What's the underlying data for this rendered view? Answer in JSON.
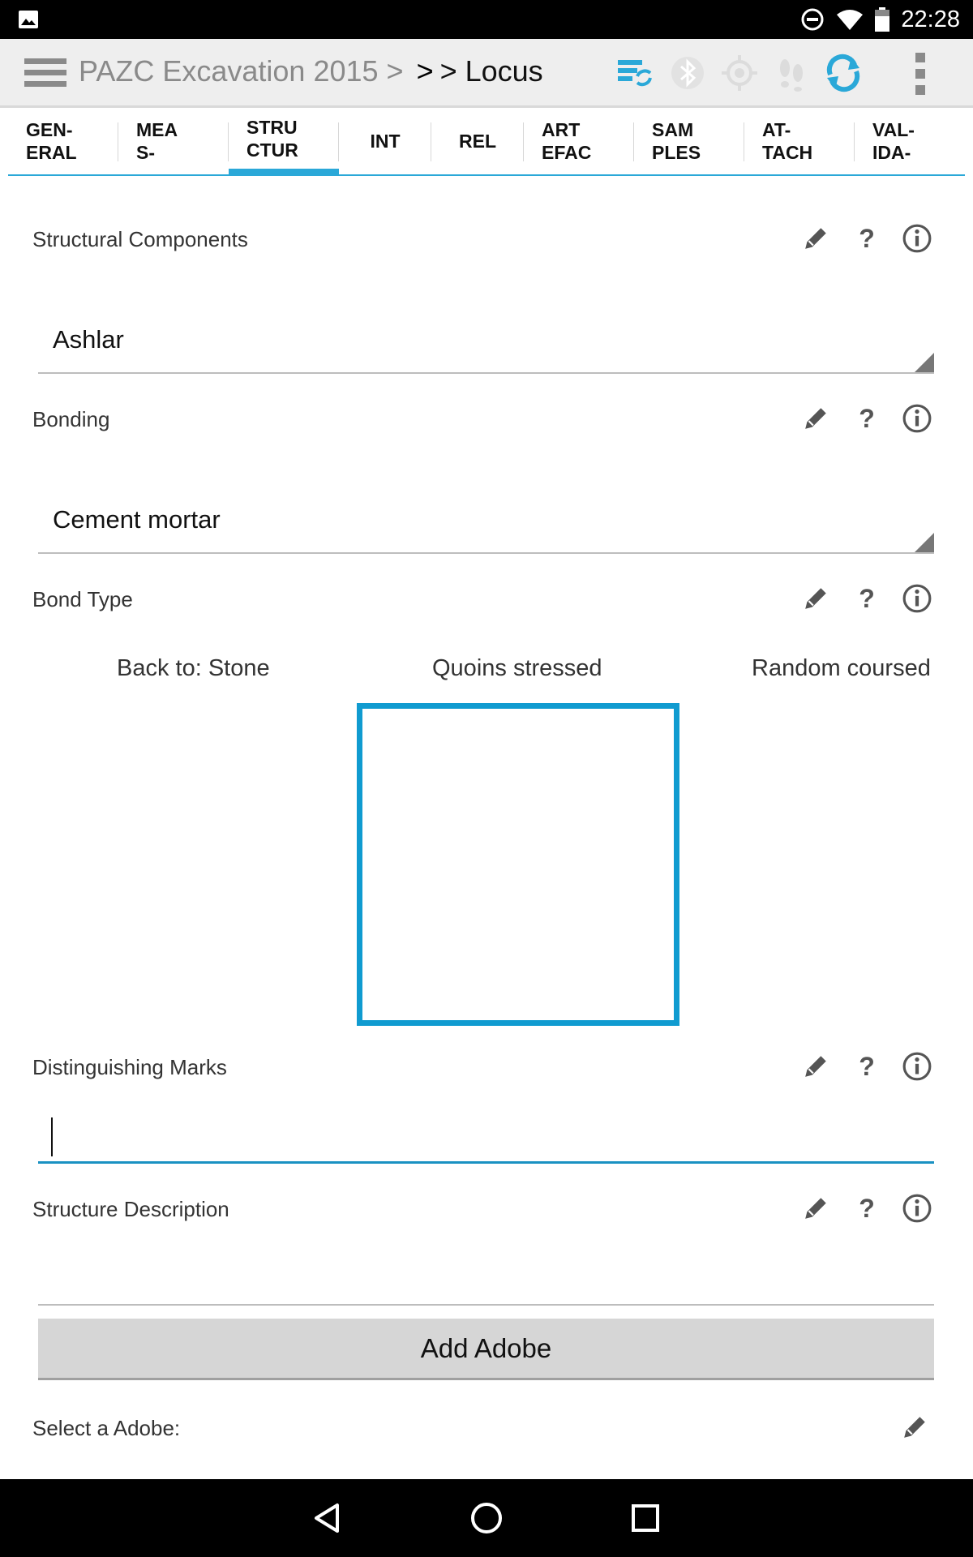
{
  "status_bar": {
    "time": "22:28"
  },
  "action_bar": {
    "breadcrumb_project": "PAZC Excavation 2015 >",
    "breadcrumb_sep": ">",
    "breadcrumb_leaf": "> Locus"
  },
  "tabs": [
    {
      "label": "GEN-\nERAL"
    },
    {
      "label": "MEA\nS-"
    },
    {
      "label": "STRU\nCTUR",
      "active": true
    },
    {
      "label": "INT"
    },
    {
      "label": "REL"
    },
    {
      "label": "ART\nEFAC"
    },
    {
      "label": "SAM\nPLES"
    },
    {
      "label": "AT-\nTACH"
    },
    {
      "label": "VAL-\nIDA-"
    }
  ],
  "fields": {
    "structural_components": {
      "label": "Structural Components",
      "value": "Ashlar"
    },
    "bonding": {
      "label": "Bonding",
      "value": "Cement mortar"
    },
    "bond_type": {
      "label": "Bond Type",
      "options": [
        "Back to: Stone",
        "Quoins stressed",
        "Random coursed"
      ]
    },
    "distinguishing_marks": {
      "label": "Distinguishing Marks",
      "value": ""
    },
    "structure_description": {
      "label": "Structure Description",
      "value": ""
    },
    "select_adobe": {
      "label": "Select a Adobe:"
    }
  },
  "buttons": {
    "add_adobe": "Add Adobe"
  },
  "icons": {
    "help_glyph": "?",
    "accent": "#2aa8d8"
  }
}
